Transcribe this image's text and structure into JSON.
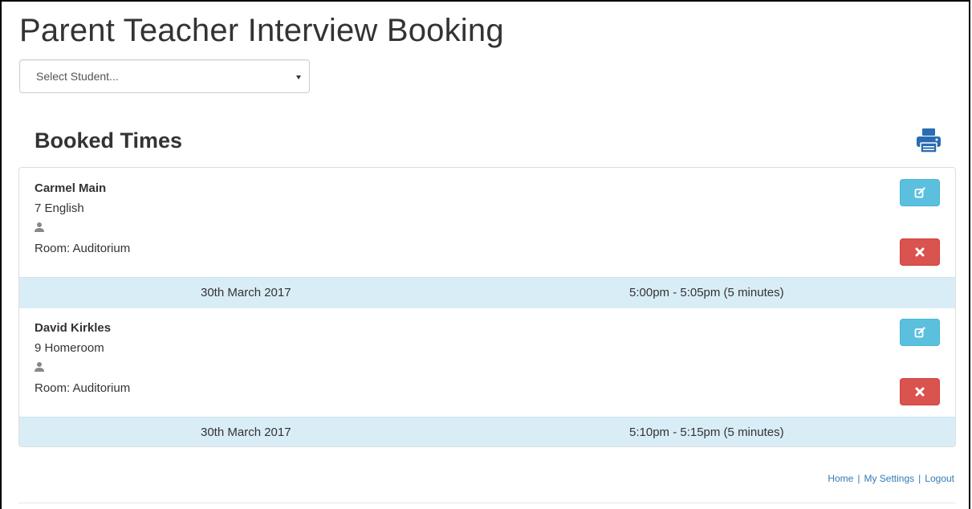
{
  "page": {
    "title": "Parent Teacher Interview Booking"
  },
  "student_select": {
    "placeholder": "Select Student..."
  },
  "booked": {
    "title": "Booked Times",
    "print_icon": "print-icon",
    "bookings": [
      {
        "teacher": "Carmel Main",
        "subject": "7 English",
        "room": "Room: Auditorium",
        "date": "30th March 2017",
        "time": "5:00pm - 5:05pm (5 minutes)"
      },
      {
        "teacher": "David Kirkles",
        "subject": "9 Homeroom",
        "room": "Room: Auditorium",
        "date": "30th March 2017",
        "time": "5:10pm - 5:15pm (5 minutes)"
      }
    ]
  },
  "footer": {
    "home": "Home",
    "settings": "My Settings",
    "logout": "Logout",
    "separator": "|"
  },
  "colors": {
    "info": "#5bc0de",
    "danger": "#d9534f",
    "row_footer": "#d9edf7",
    "link": "#337ab7",
    "print_icon": "#2a6cb3"
  }
}
